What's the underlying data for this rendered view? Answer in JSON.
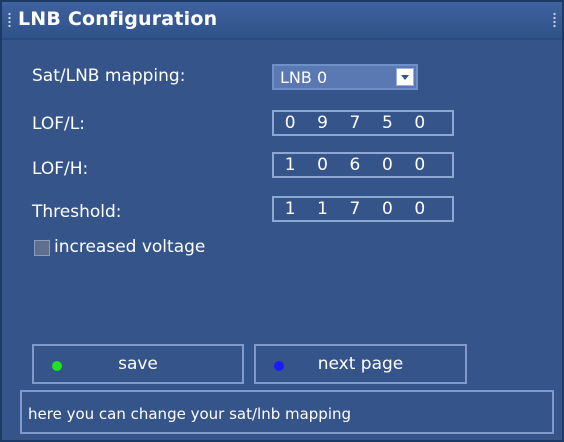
{
  "window": {
    "title": "LNB Configuration"
  },
  "settings": {
    "mapping": {
      "label": "Sat/LNB mapping:",
      "value": "LNB 0"
    },
    "lof_l": {
      "label": "LOF/L:",
      "digits": [
        "0",
        "9",
        "7",
        "5",
        "0"
      ]
    },
    "lof_h": {
      "label": "LOF/H:",
      "digits": [
        "1",
        "0",
        "6",
        "0",
        "0"
      ]
    },
    "threshold": {
      "label": "Threshold:",
      "digits": [
        "1",
        "1",
        "7",
        "0",
        "0"
      ]
    },
    "increased_voltage": {
      "label": "increased voltage",
      "checked": false
    }
  },
  "buttons": {
    "save": {
      "label": "save",
      "dot_color": "#22e022"
    },
    "next_page": {
      "label": "next page",
      "dot_color": "#1a1aff"
    }
  },
  "status": {
    "help_text": "here you can change your sat/lnb mapping"
  },
  "colors": {
    "background": "#35558a",
    "border": "#8ea8d6"
  }
}
